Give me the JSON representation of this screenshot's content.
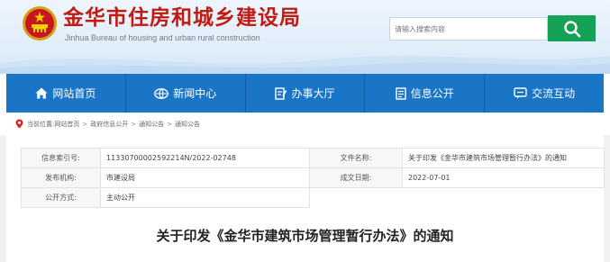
{
  "header": {
    "title": "金华市住房和城乡建设局",
    "subtitle": "Jinhua Bureau of housing and urban rural construction",
    "search_placeholder": "请输入搜索内容",
    "colors": {
      "title_red": "#c11a12",
      "search_green": "#14a257"
    }
  },
  "nav": {
    "background": "#1a75c7",
    "items": [
      {
        "label": "网站首页",
        "icon": "home-icon"
      },
      {
        "label": "新闻中心",
        "icon": "news-icon"
      },
      {
        "label": "办事大厅",
        "icon": "document-edit-icon"
      },
      {
        "label": "信息公开",
        "icon": "info-list-icon"
      },
      {
        "label": "交流互动",
        "icon": "interaction-icon"
      }
    ]
  },
  "breadcrumb": {
    "prefix": "当前位置:",
    "items": [
      "网站首页",
      "政府信息公开",
      "通知公告",
      "通知公告"
    ],
    "separator": ">"
  },
  "meta": {
    "index_label": "信息索引号:",
    "index_value": "11330700002592214N/2022-02748",
    "doc_name_label": "文件名称:",
    "doc_name_value": "关于印发《金华市建筑市场管理暂行办法》的通知",
    "issuer_label": "发布机构:",
    "issuer_value": "市建设局",
    "date_label": "成文日期:",
    "date_value": "2022-07-01",
    "method_label": "公开方式:",
    "method_value": "主动公开"
  },
  "article": {
    "title": "关于印发《金华市建筑市场管理暂行办法》的通知"
  }
}
